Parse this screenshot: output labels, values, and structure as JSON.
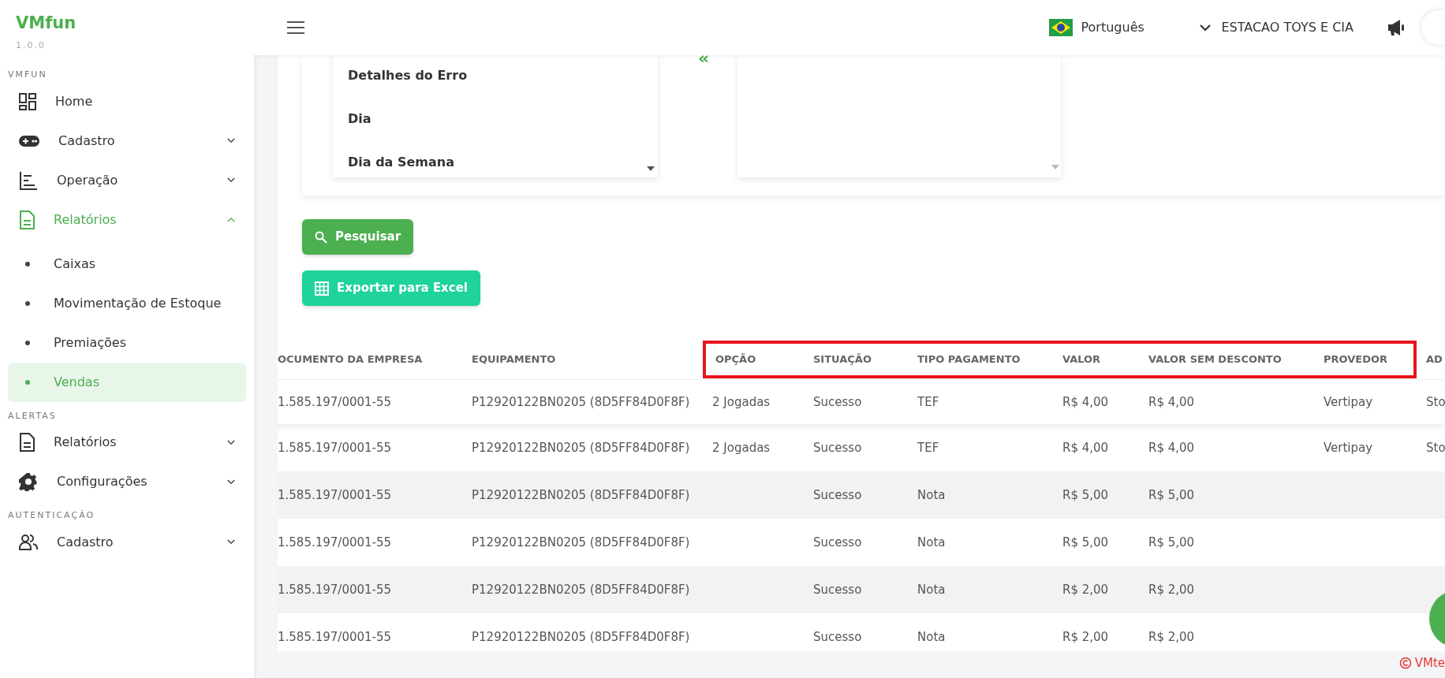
{
  "brand": {
    "name": "VMfun",
    "version": "1.0.0"
  },
  "sidebar": {
    "sections": [
      {
        "heading": "VMFUN",
        "items": [
          {
            "label": "Home",
            "kind": "link",
            "selected": false
          },
          {
            "label": "Cadastro",
            "kind": "group",
            "selected": false,
            "expanded": false
          },
          {
            "label": "Operação",
            "kind": "group",
            "selected": false,
            "expanded": false
          },
          {
            "label": "Relatórios",
            "kind": "group",
            "selected": true,
            "expanded": true,
            "children": [
              {
                "label": "Caixas",
                "selected": false
              },
              {
                "label": "Movimentação de Estoque",
                "selected": false
              },
              {
                "label": "Premiações",
                "selected": false
              },
              {
                "label": "Vendas",
                "selected": true
              }
            ]
          }
        ]
      },
      {
        "heading": "ALERTAS",
        "items": [
          {
            "label": "Relatórios",
            "kind": "group",
            "selected": false,
            "expanded": false
          },
          {
            "label": "Configurações",
            "kind": "group",
            "selected": false,
            "expanded": false
          }
        ]
      },
      {
        "heading": "AUTENTICAÇÃO",
        "items": [
          {
            "label": "Cadastro",
            "kind": "group",
            "selected": false,
            "expanded": false
          }
        ]
      }
    ]
  },
  "topbar": {
    "language": "Português",
    "company": "ESTACAO TOYS E CIA"
  },
  "fields_panel": {
    "available": [
      "Detalhes do Erro",
      "Dia",
      "Dia da Semana"
    ],
    "move_button": "«"
  },
  "buttons": [
    {
      "label": "Pesquisar",
      "kind": "search"
    },
    {
      "label": "Exportar para Excel",
      "kind": "excel"
    }
  ],
  "table": {
    "columns": [
      {
        "label": "OCUMENTO DA EMPRESA",
        "highlighted": false
      },
      {
        "label": "EQUIPAMENTO",
        "highlighted": false
      },
      {
        "label": "OPÇÃO",
        "highlighted": true
      },
      {
        "label": "SITUAÇÃO",
        "highlighted": true
      },
      {
        "label": "TIPO PAGAMENTO",
        "highlighted": true
      },
      {
        "label": "VALOR",
        "highlighted": true
      },
      {
        "label": "VALOR SEM DESCONTO",
        "highlighted": true
      },
      {
        "label": "PROVEDOR",
        "highlighted": true
      },
      {
        "label": "AD",
        "highlighted": false
      }
    ],
    "rows": [
      {
        "cells": [
          "1.585.197/0001-55",
          "P12920122BN0205 (8D5FF84D0F8F)",
          "2 Jogadas",
          "Sucesso",
          "TEF",
          "R$ 4,00",
          "R$ 4,00",
          "Vertipay",
          "Sto"
        ]
      },
      {
        "cells": [
          "1.585.197/0001-55",
          "P12920122BN0205 (8D5FF84D0F8F)",
          "2 Jogadas",
          "Sucesso",
          "TEF",
          "R$ 4,00",
          "R$ 4,00",
          "Vertipay",
          "Sto"
        ]
      },
      {
        "cells": [
          "1.585.197/0001-55",
          "P12920122BN0205 (8D5FF84D0F8F)",
          "",
          "Sucesso",
          "Nota",
          "R$ 5,00",
          "R$ 5,00",
          "",
          ""
        ]
      },
      {
        "cells": [
          "1.585.197/0001-55",
          "P12920122BN0205 (8D5FF84D0F8F)",
          "",
          "Sucesso",
          "Nota",
          "R$ 5,00",
          "R$ 5,00",
          "",
          ""
        ]
      },
      {
        "cells": [
          "1.585.197/0001-55",
          "P12920122BN0205 (8D5FF84D0F8F)",
          "",
          "Sucesso",
          "Nota",
          "R$ 2,00",
          "R$ 2,00",
          "",
          ""
        ]
      },
      {
        "cells": [
          "1.585.197/0001-55",
          "P12920122BN0205 (8D5FF84D0F8F)",
          "",
          "Sucesso",
          "Nota",
          "R$ 2,00",
          "R$ 2,00",
          "",
          ""
        ]
      }
    ]
  },
  "footer": {
    "text": "VMte"
  }
}
